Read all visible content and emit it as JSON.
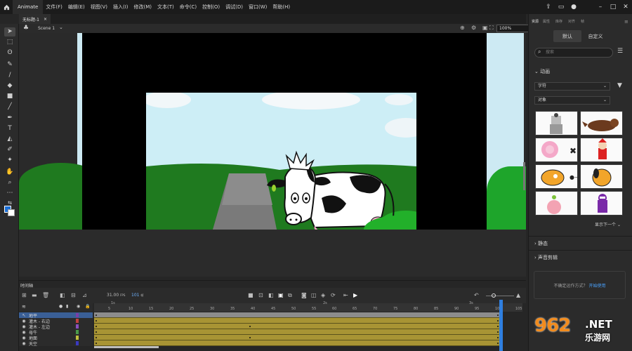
{
  "menubar": {
    "app_name": "Animate",
    "menus": [
      "文件(F)",
      "编辑(E)",
      "视图(V)",
      "插入(I)",
      "修改(M)",
      "文本(T)",
      "命令(C)",
      "控制(O)",
      "调试(D)",
      "窗口(W)",
      "帮助(H)"
    ]
  },
  "document": {
    "tab_title": "无标题-1",
    "tab_close": "×",
    "scene_label": "Scene 1",
    "zoom": "100%"
  },
  "right_panel": {
    "tabs": [
      "资源",
      "属性",
      "库存",
      "对齐",
      "帧"
    ],
    "segment_default": "默认",
    "segment_custom": "自定义",
    "search_placeholder": "搜索",
    "animation_header": "动画",
    "dropdown1": "字符",
    "dropdown2": "对象",
    "show_next": "显示下一个",
    "section_static": "静态",
    "section_audio": "声音剪辑",
    "tip_text": "不确定运作方式？",
    "tip_link": "开始使用"
  },
  "timeline": {
    "tab_label": "时间轴",
    "fps_value": "31.00",
    "fps_unit": "FPS",
    "frame_value": "101",
    "frame_unit": "帧",
    "ruler_ticks": [
      "5",
      "10",
      "15",
      "20",
      "25",
      "30",
      "35",
      "40",
      "45",
      "50",
      "55",
      "60",
      "65",
      "70",
      "75",
      "80",
      "85",
      "90",
      "95",
      "100",
      "105"
    ],
    "ruler_seconds": [
      "1s",
      "2s",
      "3s"
    ],
    "layers": [
      {
        "name": "地平",
        "selected": true,
        "color": "#7a3ea8"
      },
      {
        "name": "灌木 - 右边",
        "selected": false,
        "color": "#c04040"
      },
      {
        "name": "灌木 - 左边",
        "selected": false,
        "color": "#8a4fc0"
      },
      {
        "name": "母牛",
        "selected": false,
        "color": "#4a9a4a"
      },
      {
        "name": "地面",
        "selected": false,
        "color": "#c0c040"
      },
      {
        "name": "天空",
        "selected": false,
        "color": "#3a3ac0"
      }
    ]
  },
  "colors": {
    "accent": "#2f7fe0",
    "stroke_color": "#1b6fd6",
    "track": "#a89434"
  },
  "watermark": {
    "logo": "962",
    "net": ".NET",
    "cn": "乐游网"
  }
}
